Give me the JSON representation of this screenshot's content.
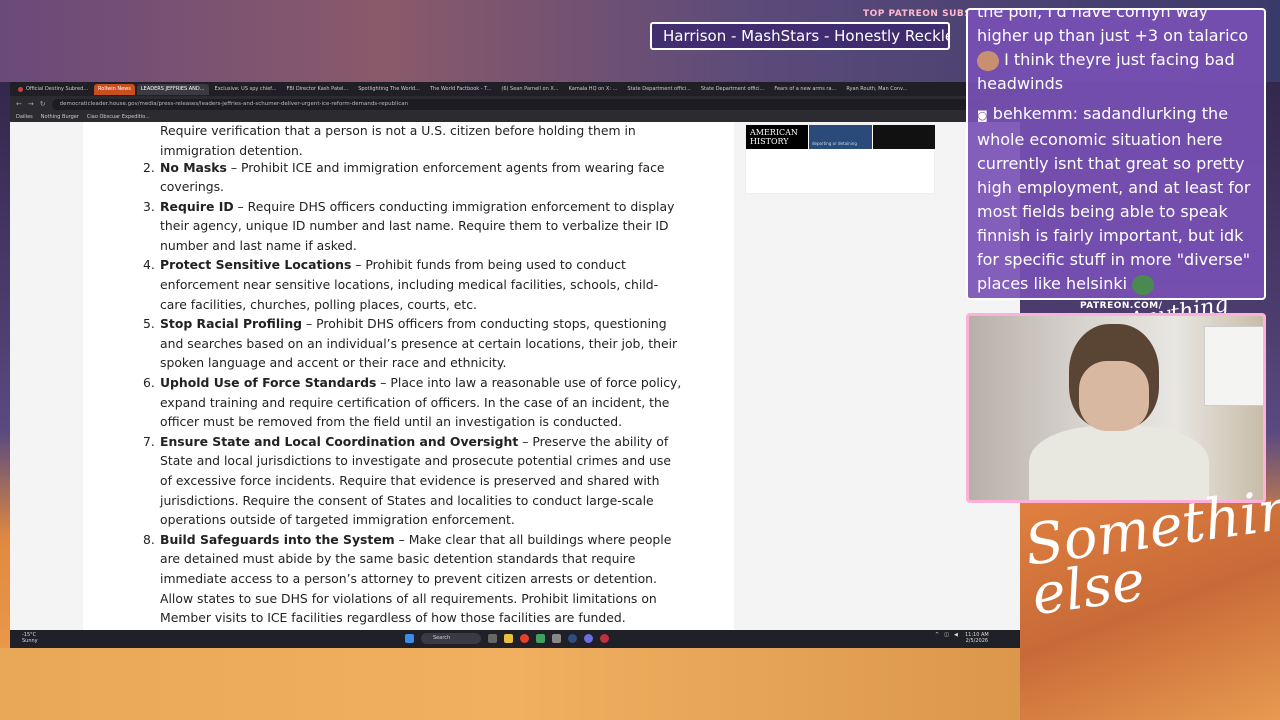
{
  "overlay": {
    "patreon_top_label": "TOP PATREON SUBS",
    "sub_banner": "Harrison - MashStars - Honestly Reckless",
    "patreon_url": "PATREON.COM/",
    "logo_small": "Anything else",
    "logo_big": "Something else"
  },
  "browser": {
    "tabs": [
      "Official Destiny Subred...",
      "Rollwin News",
      "LEADERS JEFFRIES AND...",
      "Exclusive: US spy chief...",
      "FBI Director Kash Patel...",
      "Spotlighting The World...",
      "The World Factbook - T...",
      "(6) Sean Parnell on X...",
      "Kamala HQ on X: ...",
      "State Department offici...",
      "State Department offici...",
      "Fears of a new arms ra...",
      "Ryan Routh, Man Conv..."
    ],
    "url": "democraticleader.house.gov/media/press-releases/leaders-jeffries-and-schumer-deliver-urgent-ice-reform-demands-republican",
    "bookmarks": [
      "Dailies",
      "Nothing Burger",
      "Ciao Obscuar Expeditio..."
    ],
    "ad_title": "AMERICAN HISTORY",
    "ad_mid": "deporting or detaining"
  },
  "article": {
    "lead": "Require verification that a person is not a U.S. citizen before holding them in immigration detention.",
    "items": [
      {
        "num": "2.",
        "title": "No Masks",
        "text": " – Prohibit ICE and immigration enforcement agents from wearing face coverings."
      },
      {
        "num": "3.",
        "title": "Require ID",
        "text": " – Require DHS officers conducting immigration enforcement to display their agency, unique ID number and last name. Require them to verbalize their ID number and last name if asked."
      },
      {
        "num": "4.",
        "title": "Protect Sensitive Locations",
        "text": " – Prohibit funds from being used to conduct enforcement near sensitive locations, including medical facilities, schools, child-care facilities, churches, polling places, courts, etc."
      },
      {
        "num": "5.",
        "title": "Stop Racial Profiling",
        "text": " – Prohibit DHS officers from conducting stops, questioning and searches based on an individual’s presence at certain locations, their job, their spoken language and accent or their race and ethnicity."
      },
      {
        "num": "6.",
        "title": "Uphold Use of Force Standards",
        "text": " – Place into law a reasonable use of force policy, expand training and require certification of officers. In the case of an incident, the officer must be removed from the field until an investigation is conducted."
      },
      {
        "num": "7.",
        "title": "Ensure State and Local Coordination and Oversight",
        "text": " – Preserve the ability of State and local jurisdictions to investigate and prosecute potential crimes and use of excessive force incidents. Require that evidence is preserved and shared with jurisdictions. Require the consent of States and localities to conduct large-scale operations outside of targeted immigration enforcement."
      },
      {
        "num": "8.",
        "title": "Build Safeguards into the System",
        "text": " – Make clear that all buildings where people are detained must abide by the same basic detention standards that require immediate access to a person’s attorney to prevent citizen arrests or detention. Allow states to sue DHS for violations of all requirements. Prohibit limitations on Member visits to ICE facilities regardless of how those facilities are funded."
      }
    ]
  },
  "taskbar": {
    "weather_temp": "-15°C",
    "weather_desc": "Sunny",
    "search": "Search",
    "time": "11:10 AM",
    "date": "2/5/2026"
  },
  "chat": {
    "line1": "the poll, I'd have cornyn way higher up than just +3 on talarico",
    "line1_tail": "I think theyre just facing bad headwinds",
    "user2": "behkemm:",
    "msg2": "sadandlurking the whole economic situation here currently isnt that great so pretty high employment, and at least for most fields being able to speak finnish is fairly important, but idk for specific stuff in more \"diverse\" places like helsinki"
  }
}
